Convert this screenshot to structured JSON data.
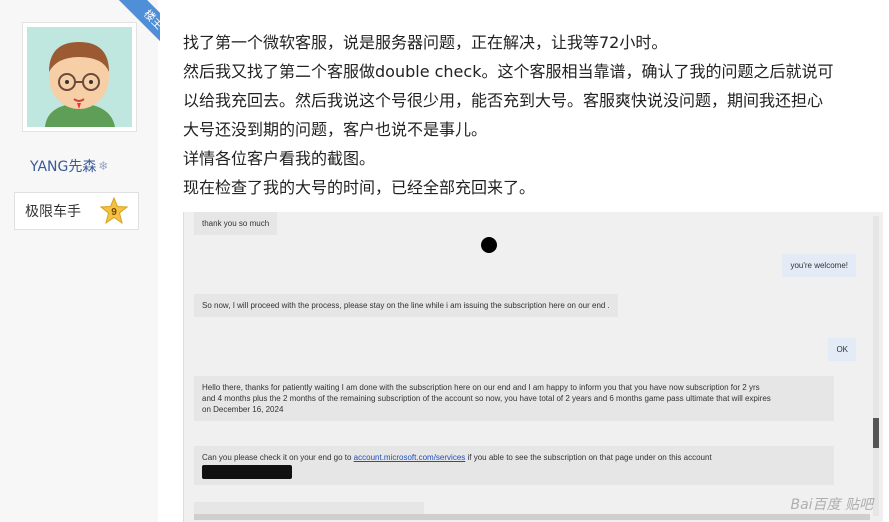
{
  "author": {
    "badge": "楼主",
    "username": "YANG先森",
    "level_label": "极限车手",
    "level_number": "9",
    "username_icon": "snowflake-icon"
  },
  "post": {
    "lines": [
      "找了第一个微软客服，说是服务器问题，正在解决，让我等72小时。",
      "然后我又找了第二个客服做double check。这个客服相当靠谱，确认了我的问题之后就说可",
      "以给我充回去。然后我说这个号很少用，能否充到大号。客服爽快说没问题，期间我还担心",
      "大号还没到期的问题，客户也说不是事儿。",
      "详情各位客户看我的截图。",
      "现在检查了我的大号的时间，已经全部充回来了。"
    ]
  },
  "chat": {
    "msg1": "thank you so much",
    "msg2": "you're welcome!",
    "msg3": "So now, I will proceed with the process, please stay on the line while i am issuing the subscription here on our end .",
    "msg4": "OK",
    "msg5_line1": "Hello there, thanks for patiently waiting I am done with the subscription here on our end and I am happy to inform you that you have now subscription for 2 yrs",
    "msg5_line2": "and 4 months plus the 2 months of the remaining subscription of the account so now, you have total of 2 years and 6 months game pass ultimate that will expires",
    "msg5_line3": "on December 16, 2024",
    "msg6_prefix": "Can you please check it on your end go to",
    "msg6_link": "account.microsoft.com/services",
    "msg6_suffix": "if you able to see the subscription on that page under on this account",
    "watermark": "Bai百度 贴吧"
  },
  "colors": {
    "badge": "#4f8fd8",
    "username": "#3b5998",
    "link": "#1f4fbf"
  }
}
